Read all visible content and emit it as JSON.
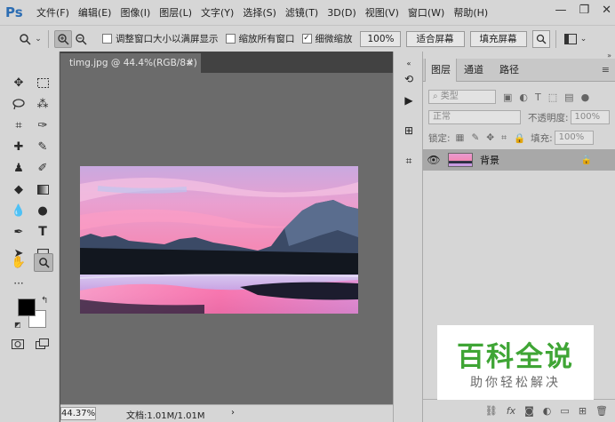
{
  "app": {
    "logo": "Ps"
  },
  "menu": [
    "文件(F)",
    "编辑(E)",
    "图像(I)",
    "图层(L)",
    "文字(Y)",
    "选择(S)",
    "滤镜(T)",
    "3D(D)",
    "视图(V)",
    "窗口(W)",
    "帮助(H)"
  ],
  "window_controls": {
    "minimize": "—",
    "restore": "❐",
    "close": "✕"
  },
  "options": {
    "resize_windows_label": "调整窗口大小以满屏显示",
    "zoom_all_label": "缩放所有窗口",
    "scrubby_zoom_label": "细微缩放",
    "scrubby_zoom_checked": true,
    "zoom_value": "100%",
    "fit_screen_label": "适合屏幕",
    "fill_screen_label": "填充屏幕"
  },
  "document": {
    "tab_title": "timg.jpg @ 44.4%(RGB/8#)",
    "close_glyph": "×"
  },
  "status": {
    "zoom": "44.37%",
    "doc_info": "文档:1.01M/1.01M",
    "arrow": "›"
  },
  "layers_panel": {
    "tabs": [
      "图层",
      "通道",
      "路径"
    ],
    "filter_kind": "类型",
    "blend_mode": "正常",
    "opacity_label": "不透明度:",
    "opacity_value": "100%",
    "lock_label": "锁定:",
    "fill_label": "填充:",
    "fill_value": "100%",
    "layers": [
      {
        "name": "背景",
        "visible": true,
        "locked": true
      }
    ],
    "footer_icons": [
      "link-icon",
      "fx-icon",
      "mask-icon",
      "adjustment-icon",
      "folder-icon",
      "new-layer-icon",
      "trash-icon"
    ]
  },
  "watermark": {
    "title": "百科全说",
    "subtitle": "助你轻松解决",
    "title_color": "#3fa535"
  }
}
